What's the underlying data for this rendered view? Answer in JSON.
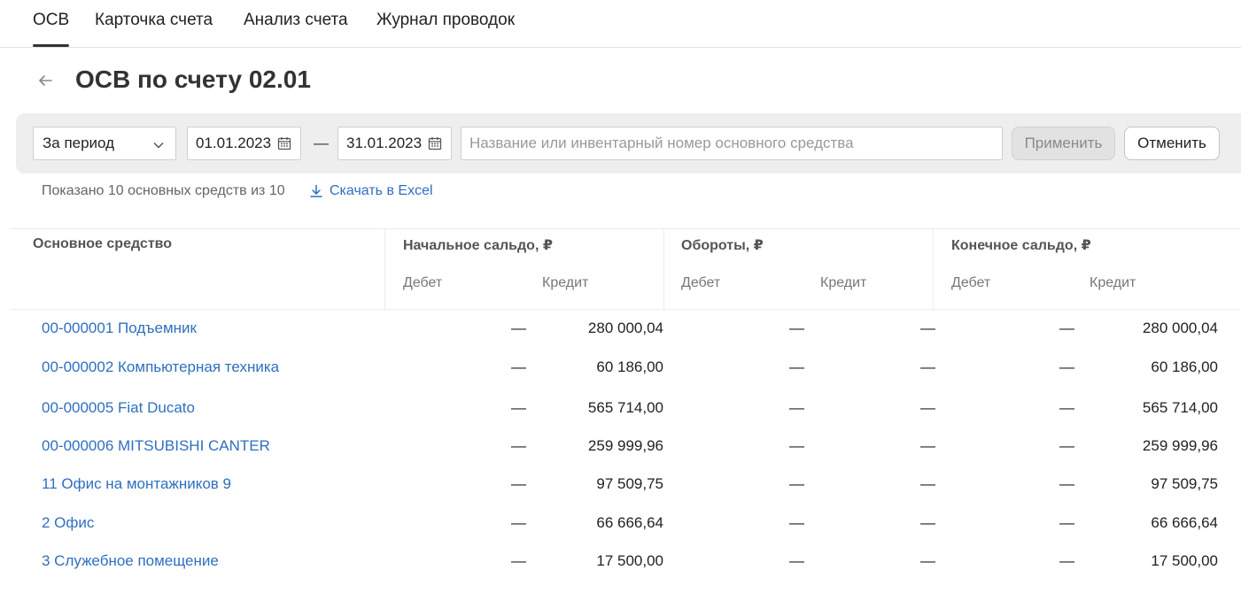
{
  "tabs": [
    "ОСВ",
    "Карточка счета",
    "Анализ счета",
    "Журнал проводок"
  ],
  "title": "ОСВ по счету 02.01",
  "filter": {
    "period": "За период",
    "date_from": "01.01.2023",
    "date_separator": "—",
    "date_to": "31.01.2023",
    "search_placeholder": "Название или инвентарный номер основного средства",
    "apply": "Применить",
    "cancel": "Отменить"
  },
  "summary": {
    "shown": "Показано 10 основных средств из 10",
    "download": "Скачать в Excel"
  },
  "table": {
    "col_asset": "Основное средство",
    "group_opening": "Начальное сальдо, ₽",
    "group_turnover": "Обороты, ₽",
    "group_closing": "Конечное сальдо, ₽",
    "debit": "Дебет",
    "credit": "Кредит",
    "rows": [
      {
        "name": "00-000001 Подъемник",
        "open_debit": "—",
        "open_credit": "280 000,04",
        "turn_debit": "—",
        "turn_credit": "—",
        "close_debit": "—",
        "close_credit": "280 000,04"
      },
      {
        "name": "00-000002 Компьютерная техника",
        "open_debit": "—",
        "open_credit": "60 186,00",
        "turn_debit": "—",
        "turn_credit": "—",
        "close_debit": "—",
        "close_credit": "60 186,00"
      },
      {
        "name": "00-000005 Fiat Ducato",
        "open_debit": "—",
        "open_credit": "565 714,00",
        "turn_debit": "—",
        "turn_credit": "—",
        "close_debit": "—",
        "close_credit": "565 714,00"
      },
      {
        "name": "00-000006 MITSUBISHI CANTER",
        "open_debit": "—",
        "open_credit": "259 999,96",
        "turn_debit": "—",
        "turn_credit": "—",
        "close_debit": "—",
        "close_credit": "259 999,96"
      },
      {
        "name": "11 Офис на монтажников 9",
        "open_debit": "—",
        "open_credit": "97 509,75",
        "turn_debit": "—",
        "turn_credit": "—",
        "close_debit": "—",
        "close_credit": "97 509,75"
      },
      {
        "name": "2 Офис",
        "open_debit": "—",
        "open_credit": "66 666,64",
        "turn_debit": "—",
        "turn_credit": "—",
        "close_debit": "—",
        "close_credit": "66 666,64"
      },
      {
        "name": "3 Служебное помещение",
        "open_debit": "—",
        "open_credit": "17 500,00",
        "turn_debit": "—",
        "turn_credit": "—",
        "close_debit": "—",
        "close_credit": "17 500,00"
      }
    ]
  },
  "colors": {
    "link": "#2f6fbf",
    "filter_bg": "#eeeeee",
    "active_underline": "#333333"
  }
}
